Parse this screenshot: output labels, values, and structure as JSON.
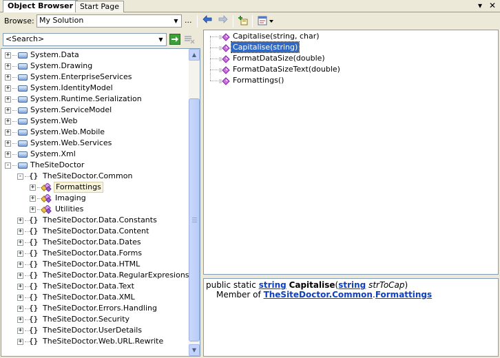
{
  "tabs": [
    {
      "label": "Object Browser",
      "active": true
    },
    {
      "label": "Start Page",
      "active": false
    }
  ],
  "window_controls": {
    "dropdown_icon": "chevron-down-icon",
    "close_glyph": "✕"
  },
  "toolbar": {
    "browse_label": "Browse:",
    "browse_value": "My Solution",
    "ellipsis": "...",
    "icons": [
      "back-arrow-icon",
      "forward-arrow-icon",
      "add-reference-icon",
      "settings-icon"
    ]
  },
  "search": {
    "value": "<Search>",
    "go_icon": "go-arrow-icon",
    "clear_icon": "clear-search-icon"
  },
  "tree": [
    {
      "label": "System.Data",
      "level": 0,
      "kind": "assembly",
      "expander": "+"
    },
    {
      "label": "System.Drawing",
      "level": 0,
      "kind": "assembly",
      "expander": "+"
    },
    {
      "label": "System.EnterpriseServices",
      "level": 0,
      "kind": "assembly",
      "expander": "+"
    },
    {
      "label": "System.IdentityModel",
      "level": 0,
      "kind": "assembly",
      "expander": "+"
    },
    {
      "label": "System.Runtime.Serialization",
      "level": 0,
      "kind": "assembly",
      "expander": "+"
    },
    {
      "label": "System.ServiceModel",
      "level": 0,
      "kind": "assembly",
      "expander": "+"
    },
    {
      "label": "System.Web",
      "level": 0,
      "kind": "assembly",
      "expander": "+"
    },
    {
      "label": "System.Web.Mobile",
      "level": 0,
      "kind": "assembly",
      "expander": "+"
    },
    {
      "label": "System.Web.Services",
      "level": 0,
      "kind": "assembly",
      "expander": "+"
    },
    {
      "label": "System.Xml",
      "level": 0,
      "kind": "assembly",
      "expander": "+"
    },
    {
      "label": "TheSiteDoctor",
      "level": 0,
      "kind": "assembly",
      "expander": "-"
    },
    {
      "label": "TheSiteDoctor.Common",
      "level": 1,
      "kind": "namespace",
      "expander": "-"
    },
    {
      "label": "Formattings",
      "level": 2,
      "kind": "class",
      "expander": "+",
      "selected": true
    },
    {
      "label": "Imaging",
      "level": 2,
      "kind": "class",
      "expander": "+"
    },
    {
      "label": "Utilities",
      "level": 2,
      "kind": "class",
      "expander": "+"
    },
    {
      "label": "TheSiteDoctor.Data.Constants",
      "level": 1,
      "kind": "namespace",
      "expander": "+"
    },
    {
      "label": "TheSiteDoctor.Data.Content",
      "level": 1,
      "kind": "namespace",
      "expander": "+"
    },
    {
      "label": "TheSiteDoctor.Data.Dates",
      "level": 1,
      "kind": "namespace",
      "expander": "+"
    },
    {
      "label": "TheSiteDoctor.Data.Forms",
      "level": 1,
      "kind": "namespace",
      "expander": "+"
    },
    {
      "label": "TheSiteDoctor.Data.HTML",
      "level": 1,
      "kind": "namespace",
      "expander": "+"
    },
    {
      "label": "TheSiteDoctor.Data.RegularExpresions",
      "level": 1,
      "kind": "namespace",
      "expander": "+"
    },
    {
      "label": "TheSiteDoctor.Data.Text",
      "level": 1,
      "kind": "namespace",
      "expander": "+"
    },
    {
      "label": "TheSiteDoctor.Data.XML",
      "level": 1,
      "kind": "namespace",
      "expander": "+"
    },
    {
      "label": "TheSiteDoctor.Errors.Handling",
      "level": 1,
      "kind": "namespace",
      "expander": "+"
    },
    {
      "label": "TheSiteDoctor.Security",
      "level": 1,
      "kind": "namespace",
      "expander": "+"
    },
    {
      "label": "TheSiteDoctor.UserDetails",
      "level": 1,
      "kind": "namespace",
      "expander": "+"
    },
    {
      "label": "TheSiteDoctor.Web.URL.Rewrite",
      "level": 1,
      "kind": "namespace",
      "expander": "+"
    }
  ],
  "namespace_glyph": "{}",
  "members": [
    {
      "label": "Capitalise(string, char)",
      "selected": false
    },
    {
      "label": "Capitalise(string)",
      "selected": true
    },
    {
      "label": "FormatDataSize(double)",
      "selected": false
    },
    {
      "label": "FormatDataSizeText(double)",
      "selected": false
    },
    {
      "label": "Formattings()",
      "selected": false
    }
  ],
  "description": {
    "line1_prefix": "public static ",
    "return_type": "string",
    "method_name": "Capitalise",
    "open_paren": "(",
    "param_type": "string",
    "param_name": "strToCap",
    "close_paren": ")",
    "member_of_prefix": "Member of ",
    "member_of_namespace": "TheSiteDoctor.Common",
    "dot": ".",
    "member_of_class": "Formattings"
  },
  "colors": {
    "selection": "#316ac5",
    "link": "#1040c0",
    "border": "#7f9db9",
    "chrome": "#ece9d8"
  }
}
